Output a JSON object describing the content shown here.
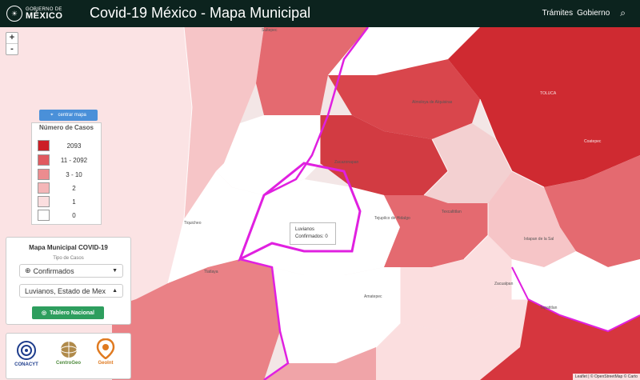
{
  "header": {
    "logo_line1": "GOBIERNO DE",
    "logo_line2": "MÉXICO",
    "title": "Covid-19 México - Mapa Municipal",
    "nav": [
      "Trámites",
      "Gobierno"
    ]
  },
  "colors": {
    "header_bg": "#0c231e",
    "accent_button": "#4a90d9",
    "tablero_button": "#2e9e5e",
    "selected_outline": "#e020e0"
  },
  "map_controls": {
    "zoom_in": "+",
    "zoom_out": "-",
    "centrar": "centrar mapa"
  },
  "legend": {
    "title": "Número de Casos",
    "items": [
      {
        "label": "2093",
        "color": "#cc1f26"
      },
      {
        "label": "11 - 2092",
        "color": "#e05a5f"
      },
      {
        "label": "3 - 10",
        "color": "#ec8c8f"
      },
      {
        "label": "2",
        "color": "#f4b6b8"
      },
      {
        "label": "1",
        "color": "#fbdedf"
      },
      {
        "label": "0",
        "color": "#ffffff"
      }
    ]
  },
  "panel": {
    "title": "Mapa Municipal COVID-19",
    "subtitle": "Tipo de Casos",
    "case_type": "Confirmados",
    "municipality": "Luvianos, Estado de Mex",
    "tablero": "Tablero Nacional"
  },
  "sponsors": [
    "CONACYT",
    "CentroGeo",
    "GeoInt"
  ],
  "popup": {
    "name": "Luvianos",
    "value": "Confirmados: 0"
  },
  "places": {
    "p1": "Sultepec",
    "p2": "Almoloya de Alquisiras",
    "p3": "Zacazonapan",
    "p4": "Tejupilco de Hidalgo",
    "p5": "Texcaltitlan",
    "p6": "Tiquicheo",
    "p7": "Amatepec",
    "p8": "Zacualpan",
    "p9": "Tlatlaya",
    "p10": "Tepatitlan",
    "p11": "Ixtapan de la Sal",
    "p12": "TOLUCA",
    "p13": "Coatepec"
  },
  "attribution": "Leaflet | © OpenStreetMap © Carto"
}
